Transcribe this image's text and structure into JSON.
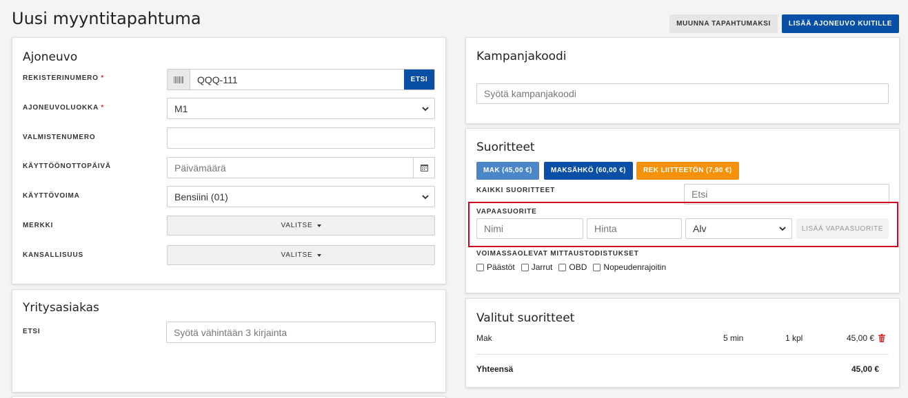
{
  "page": {
    "title": "Uusi myyntitapahtuma",
    "convert_button": "MUUNNA TAPAHTUMAKSI",
    "add_vehicle_button": "LISÄÄ AJONEUVO KUITILLE"
  },
  "vehicle": {
    "title": "Ajoneuvo",
    "reg_label": "REKISTERINUMERO",
    "reg_value": "QQQ-111",
    "search_button": "ETSI",
    "class_label": "AJONEUVOLUOKKA",
    "class_value": "M1",
    "serial_label": "VALMISTENUMERO",
    "serial_value": "",
    "date_label": "KÄYTTÖÖNOTTOPÄIVÄ",
    "date_placeholder": "Päivämäärä",
    "fuel_label": "KÄYTTÖVOIMA",
    "fuel_value": "Bensiini (01)",
    "brand_label": "MERKKI",
    "brand_button": "VALITSE",
    "nationality_label": "KANSALLISUUS",
    "nationality_button": "VALITSE",
    "required_mark": "*"
  },
  "company": {
    "title": "Yritysasiakas",
    "search_label": "ETSI",
    "search_placeholder": "Syötä vähintään 3 kirjainta"
  },
  "campaign": {
    "title": "Kampanjakoodi",
    "placeholder": "Syötä kampanjakoodi"
  },
  "services": {
    "title": "Suoritteet",
    "chips": [
      {
        "label": "MAK (45,00 €)",
        "color": "#4a86c8"
      },
      {
        "label": "MAKSÄHKÖ (60,00 €)",
        "color": "#0a4fa6"
      },
      {
        "label": "REK LIITTEETÖN (7,90 €)",
        "color": "#f5920a"
      }
    ],
    "all_label": "KAIKKI SUORITTEET",
    "search_placeholder": "Etsi",
    "free_label": "VAPAASUORITE",
    "name_placeholder": "Nimi",
    "price_placeholder": "Hinta",
    "vat_value": "Alv",
    "add_free_button": "LISÄÄ VAPAASUORITE",
    "valid_label": "VOIMASSAOLEVAT MITTAUSTODISTUKSET",
    "checkboxes": [
      "Päästöt",
      "Jarrut",
      "OBD",
      "Nopeudenrajoitin"
    ]
  },
  "selected": {
    "title": "Valitut suoritteet",
    "rows": [
      {
        "name": "Mak",
        "duration": "5 min",
        "qty": "1 kpl",
        "price": "45,00 €"
      }
    ],
    "total_label": "Yhteensä",
    "total_value": "45,00 €"
  },
  "colors": {
    "primary": "#0a4fa6",
    "highlight": "#d0021b",
    "danger": "#d32f2f"
  }
}
